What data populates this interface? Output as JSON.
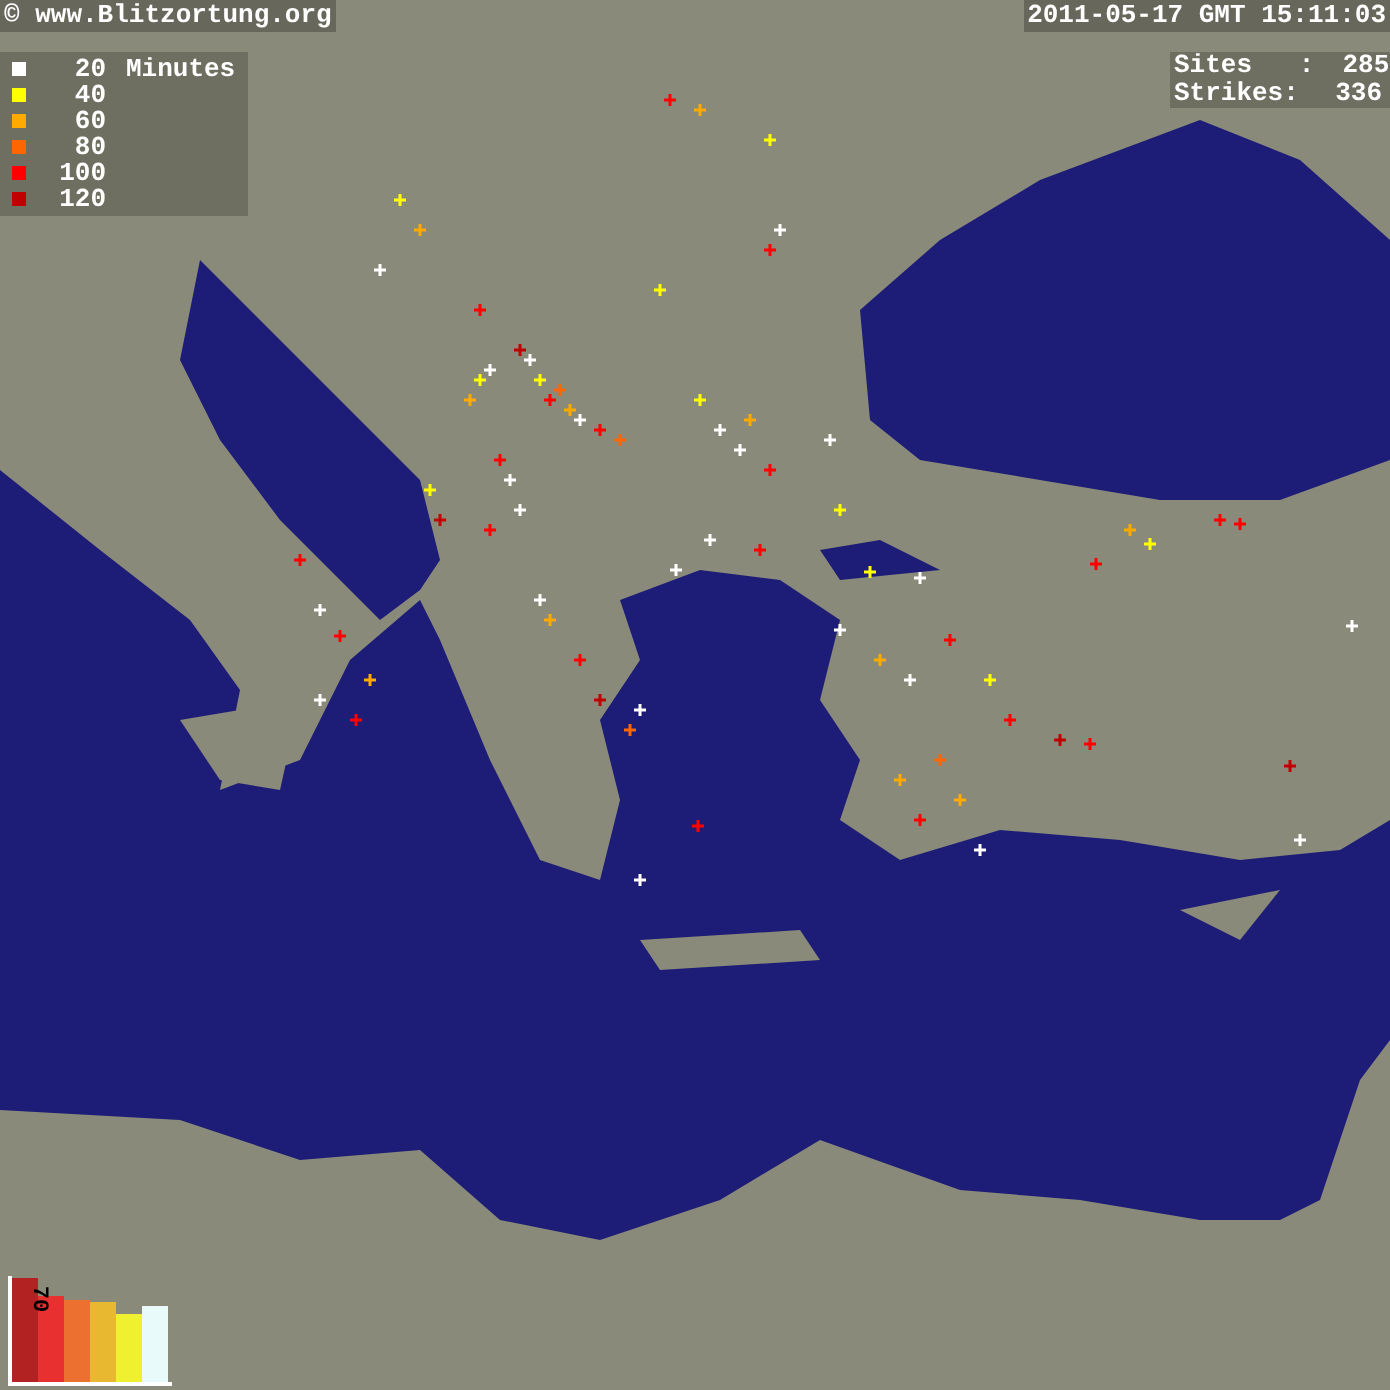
{
  "header": {
    "site": "© www.Blitzortung.org",
    "timestamp": "2011-05-17 GMT 15:11:03"
  },
  "stats": [
    {
      "label": "Sites   :",
      "value": "285"
    },
    {
      "label": "Strikes:",
      "value": "336"
    }
  ],
  "legend": {
    "unit": "Minutes",
    "items": [
      {
        "label": "20",
        "color": "#ffffff"
      },
      {
        "label": "40",
        "color": "#ffff00"
      },
      {
        "label": "60",
        "color": "#ffaa00"
      },
      {
        "label": "80",
        "color": "#ff6600"
      },
      {
        "label": "100",
        "color": "#ff0000"
      },
      {
        "label": "120",
        "color": "#c00000"
      }
    ]
  },
  "histogram": {
    "label": "70"
  }
}
